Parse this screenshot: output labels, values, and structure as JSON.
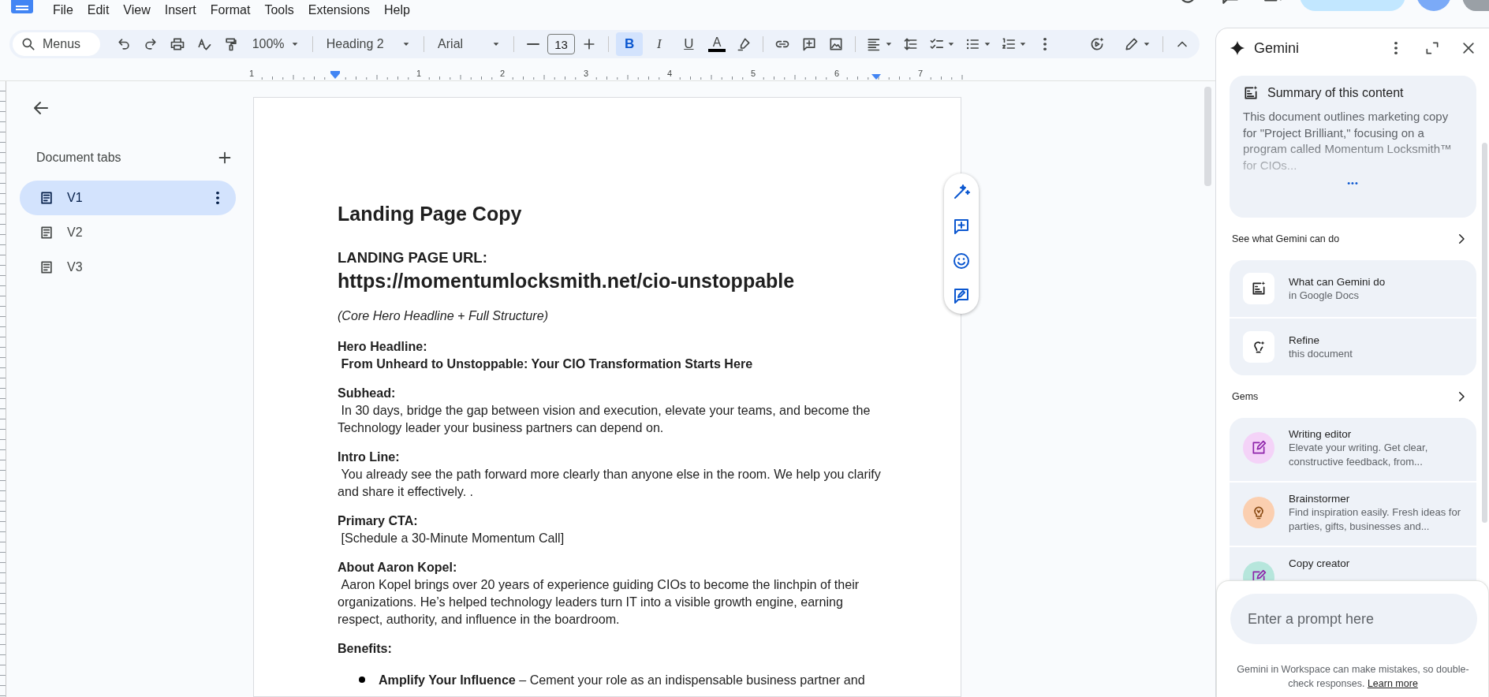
{
  "menu": [
    "File",
    "Edit",
    "View",
    "Insert",
    "Format",
    "Tools",
    "Extensions",
    "Help"
  ],
  "toolbar": {
    "search_placeholder": "Menus",
    "zoom": "100%",
    "style": "Heading 2",
    "font": "Arial",
    "font_size": "13",
    "format_buttons": [
      {
        "kind": "bold",
        "label": "B",
        "selected": true
      },
      {
        "kind": "italic",
        "label": "I",
        "selected": false
      },
      {
        "kind": "underline",
        "label": "U",
        "selected": false
      }
    ],
    "text_color_label": "A"
  },
  "ruler": {
    "labels": [
      "1",
      "1",
      "2",
      "3",
      "4",
      "5",
      "6",
      "7"
    ]
  },
  "tabs_panel": {
    "title": "Document tabs",
    "tabs": [
      {
        "label": "V1",
        "selected": true
      },
      {
        "label": "V2",
        "selected": false
      },
      {
        "label": "V3",
        "selected": false
      }
    ]
  },
  "document": {
    "blocks": [
      {
        "kind": "title",
        "text": "Landing Page Copy"
      },
      {
        "kind": "label",
        "text": "LANDING PAGE URL:"
      },
      {
        "kind": "url",
        "text": "https://momentumlocksmith.net/cio-unstoppable"
      },
      {
        "kind": "note",
        "text": "(Core Hero Headline + Full Structure)"
      },
      {
        "kind": "section",
        "heading": "Hero Headline:",
        "body": " From Unheard to Unstoppable: Your CIO Transformation Starts Here",
        "bold_body": true
      },
      {
        "kind": "section",
        "heading": "Subhead:",
        "body": " In 30 days, bridge the gap between vision and execution, elevate your teams, and become the Technology leader your business partners can depend on.",
        "bold_body": false
      },
      {
        "kind": "section",
        "heading": "Intro Line:",
        "body": " You already see the path forward more clearly than anyone else in the room. We help you clarify and share it effectively. .",
        "bold_body": false
      },
      {
        "kind": "section",
        "heading": "Primary CTA:",
        "body": " [Schedule a 30-Minute Momentum Call]",
        "bold_body": false
      },
      {
        "kind": "section",
        "heading": "About Aaron Kopel:",
        "body": " Aaron Kopel brings over 20 years of experience guiding CIOs to become the linchpin of their organizations. He’s helped technology leaders turn IT into a visible growth engine, earning respect, authority, and influence in the boardroom.",
        "bold_body": false
      },
      {
        "kind": "section",
        "heading": "Benefits:"
      },
      {
        "kind": "bullets",
        "items": [
          "**Amplify Your Influence** – Cement your role as an indispensable business partner and"
        ]
      }
    ]
  },
  "gemini": {
    "title": "Gemini",
    "summary": {
      "title": "Summary of this content",
      "text": "This document outlines marketing copy for \"Project Brilliant,\" focusing on a program called Momentum Locksmith™ for CIOs...",
      "more": "•••"
    },
    "sections": [
      {
        "title": "See what Gemini can do",
        "items": [
          {
            "kind": "tile",
            "title": "What can Gemini do",
            "subtitle": "in Google Docs"
          },
          {
            "kind": "tile",
            "title": "Refine",
            "subtitle": "this document"
          }
        ]
      },
      {
        "title": "Gems",
        "items": [
          {
            "kind": "gem",
            "title": "Writing editor",
            "subtitle": "Elevate your writing. Get clear, constructive feedback, from...",
            "color": "#f4d3f8"
          },
          {
            "kind": "gem",
            "title": "Brainstormer",
            "subtitle": "Find inspiration easily. Fresh ideas for parties, gifts, businesses and...",
            "color": "#fbcfb0"
          },
          {
            "kind": "gem",
            "title": "Copy creator",
            "color": "#b6e6dc"
          }
        ]
      }
    ],
    "prompt": {
      "placeholder": "Enter a prompt here"
    },
    "disclaimer": "Gemini in Workspace can make mistakes, so double-check responses.",
    "link": "Learn more"
  }
}
